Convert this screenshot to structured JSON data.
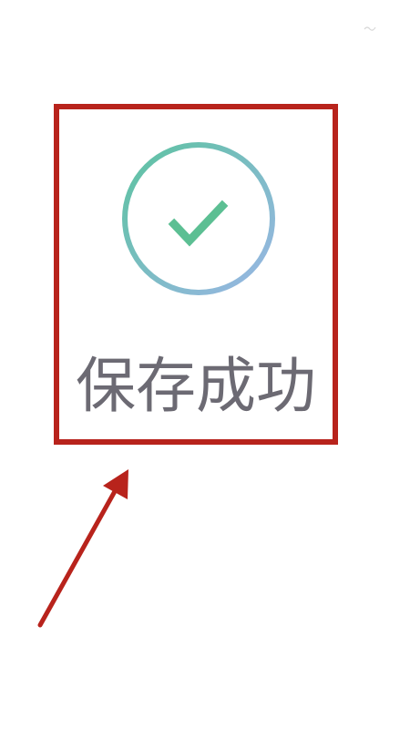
{
  "toast": {
    "message": "保存成功",
    "icon": "checkmark-circle-icon",
    "gradient_start": "#5cc3a0",
    "gradient_end": "#9ab6e6",
    "check_color": "#5cbf93"
  },
  "annotations": {
    "highlight_color": "#b8231c",
    "arrow_color": "#b8231c"
  }
}
